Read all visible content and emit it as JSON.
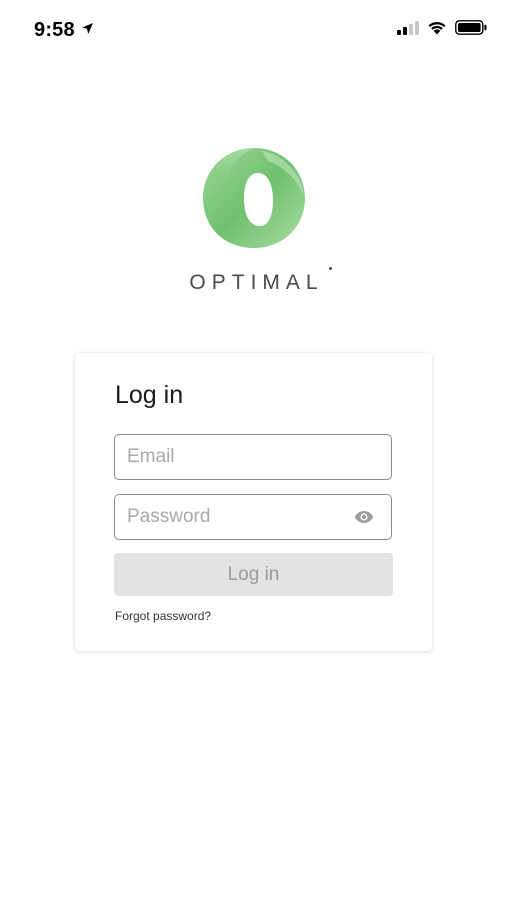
{
  "status_bar": {
    "time": "9:58",
    "icons": [
      "location-arrow-icon",
      "cellular-signal-icon",
      "wifi-icon",
      "battery-icon"
    ]
  },
  "brand": {
    "name": "OPTIMAL",
    "logo_icon": "optimal-logo-icon",
    "colors": {
      "logo_green": "#7cc47a",
      "logo_green_light": "#b6e0b1",
      "wordmark": "#4a4a4a"
    }
  },
  "login": {
    "title": "Log in",
    "email": {
      "placeholder": "Email",
      "value": ""
    },
    "password": {
      "placeholder": "Password",
      "value": "",
      "toggle_icon": "eye-icon"
    },
    "submit_label": "Log in",
    "forgot_label": "Forgot password?",
    "colors": {
      "button_disabled_bg": "#e3e3e3",
      "button_disabled_text": "#9a9a9a",
      "field_border": "#8a8a8a"
    }
  }
}
